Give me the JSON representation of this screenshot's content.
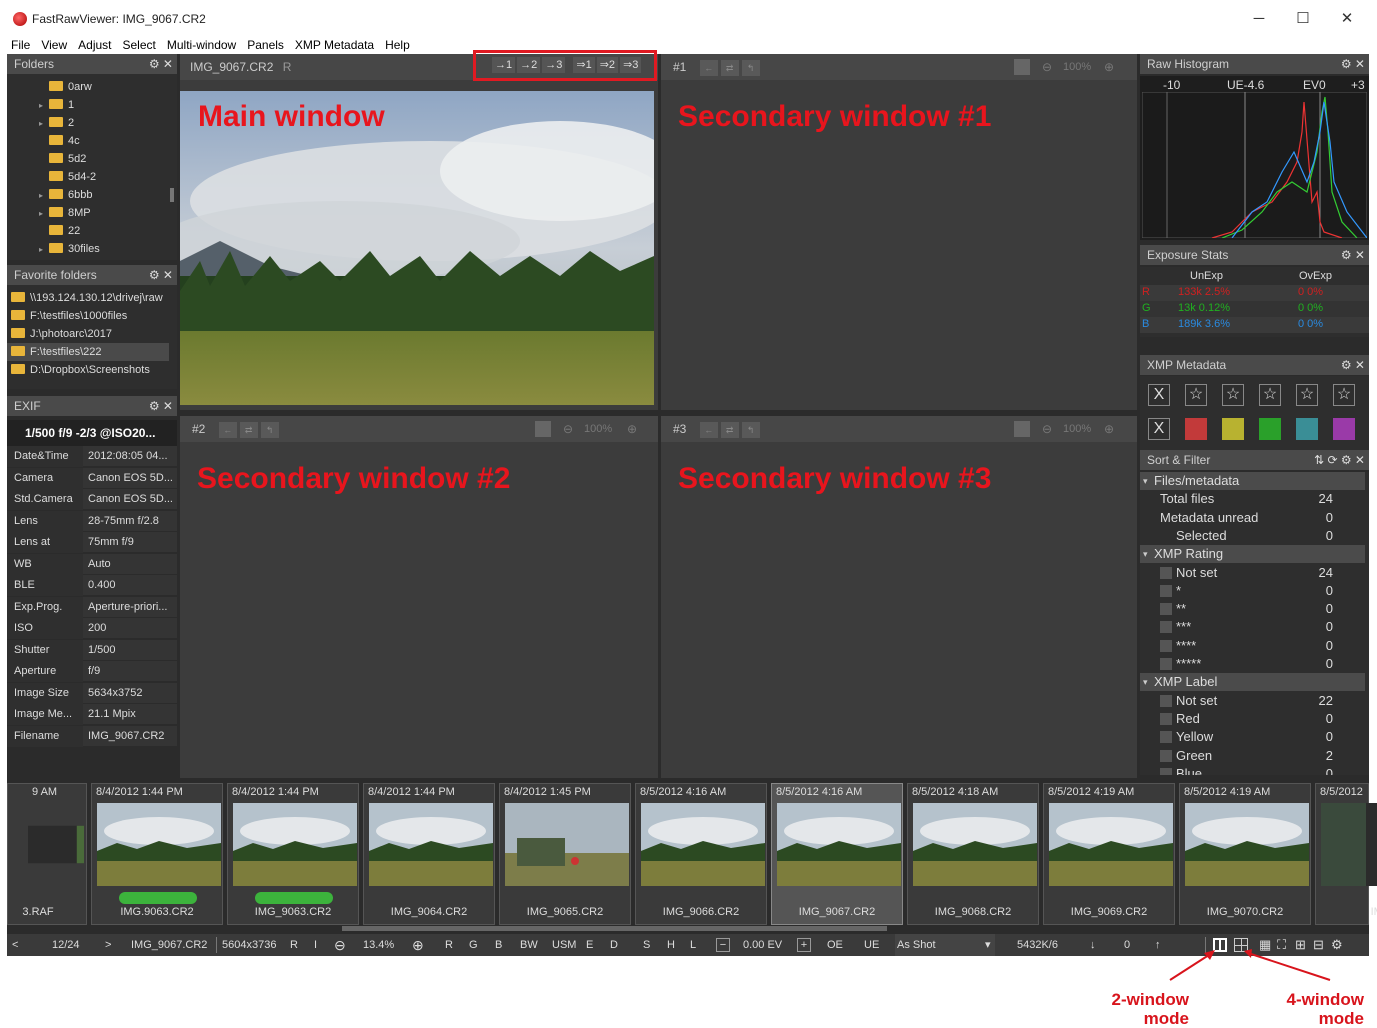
{
  "window": {
    "title": "FastRawViewer: IMG_9067.CR2",
    "min": "─",
    "max": "☐",
    "close": "✕"
  },
  "menu": [
    "File",
    "View",
    "Adjust",
    "Select",
    "Multi-window",
    "Panels",
    "XMP Metadata",
    "Help"
  ],
  "folders": {
    "title": "Folders",
    "items": [
      {
        "label": "0arw",
        "exp": ""
      },
      {
        "label": "1",
        "exp": "▸"
      },
      {
        "label": "2",
        "exp": "▸"
      },
      {
        "label": "4c",
        "exp": ""
      },
      {
        "label": "5d2",
        "exp": ""
      },
      {
        "label": "5d4-2",
        "exp": ""
      },
      {
        "label": "6bbb",
        "exp": "▸"
      },
      {
        "label": "8MP",
        "exp": "▸"
      },
      {
        "label": "22",
        "exp": ""
      },
      {
        "label": "30files",
        "exp": "▸"
      }
    ]
  },
  "favorites": {
    "title": "Favorite folders",
    "items": [
      "\\\\193.124.130.12\\drivej\\raw",
      "F:\\testfiles\\1000files",
      "J:\\photoarc\\2017",
      "F:\\testfiles\\222",
      "D:\\Dropbox\\Screenshots"
    ]
  },
  "exif": {
    "title": "EXIF",
    "summary": "1/500 f/9 -2/3 @ISO20...",
    "rows": [
      {
        "k": "Date&Time",
        "v": "2012:08:05 04..."
      },
      {
        "k": "Camera",
        "v": "Canon EOS 5D..."
      },
      {
        "k": "Std.Camera",
        "v": "Canon EOS 5D..."
      },
      {
        "k": "Lens",
        "v": "28-75mm f/2.8"
      },
      {
        "k": "Lens at",
        "v": "75mm f/9"
      },
      {
        "k": "WB",
        "v": "Auto"
      },
      {
        "k": "BLE",
        "v": "0.400"
      },
      {
        "k": "Exp.Prog.",
        "v": "Aperture-priori..."
      },
      {
        "k": "ISO",
        "v": "200"
      },
      {
        "k": "Shutter",
        "v": "1/500"
      },
      {
        "k": "Aperture",
        "v": "f/9"
      },
      {
        "k": "Image Size",
        "v": "5634x3752"
      },
      {
        "k": "Image Me...",
        "v": "21.1 Mpix"
      },
      {
        "k": "Filename",
        "v": "IMG_9067.CR2"
      }
    ]
  },
  "main": {
    "filename": "IMG_9067.CR2",
    "flag": "R",
    "label": "Main window",
    "push": [
      "→1",
      "→2",
      "→3",
      "⇒1",
      "⇒2",
      "⇒3"
    ]
  },
  "sec1": {
    "id": "#1",
    "zoom": "100%",
    "label": "Secondary window #1"
  },
  "sec2": {
    "id": "#2",
    "zoom": "100%",
    "label": "Secondary window #2"
  },
  "sec3": {
    "id": "#3",
    "zoom": "100%",
    "label": "Secondary window #3"
  },
  "histogram": {
    "title": "Raw Histogram",
    "labels": [
      "-10",
      "UE-4.6",
      "EV0",
      "+3"
    ]
  },
  "exposure": {
    "title": "Exposure Stats",
    "cols": [
      "UnExp",
      "OvExp"
    ],
    "rows": [
      {
        "ch": "R",
        "un": "133k 2.5%",
        "ov": "0 0%",
        "color": "#d02020"
      },
      {
        "ch": "G",
        "un": "13k 0.12%",
        "ov": "0 0%",
        "color": "#20b020"
      },
      {
        "ch": "B",
        "un": "189k 3.6%",
        "ov": "0 0%",
        "color": "#2a8adf"
      }
    ]
  },
  "xmp": {
    "title": "XMP Metadata",
    "reject": "X",
    "star": "☆",
    "colors": [
      "#c23a3a",
      "#b8b230",
      "#2aa02a",
      "#3a8e96",
      "#9a3aa8"
    ]
  },
  "sortfilter": {
    "title": "Sort & Filter",
    "rows": [
      {
        "t": "Files/metadata",
        "n": "",
        "g": true
      },
      {
        "t": "Total files",
        "n": "24",
        "i": 1
      },
      {
        "t": "Metadata unread",
        "n": "0",
        "i": 1
      },
      {
        "t": "Selected",
        "n": "0",
        "i": 2
      },
      {
        "t": "XMP Rating",
        "n": "",
        "g": true
      },
      {
        "t": "Not set",
        "n": "24",
        "cb": true
      },
      {
        "t": "*",
        "n": "0",
        "cb": true
      },
      {
        "t": "**",
        "n": "0",
        "cb": true
      },
      {
        "t": "***",
        "n": "0",
        "cb": true
      },
      {
        "t": "****",
        "n": "0",
        "cb": true
      },
      {
        "t": "*****",
        "n": "0",
        "cb": true
      },
      {
        "t": "XMP Label",
        "n": "",
        "g": true
      },
      {
        "t": "Not set",
        "n": "22",
        "cb": true
      },
      {
        "t": "Red",
        "n": "0",
        "cb": true
      },
      {
        "t": "Yellow",
        "n": "0",
        "cb": true
      },
      {
        "t": "Green",
        "n": "2",
        "cb": true
      },
      {
        "t": "Blue",
        "n": "0",
        "cb": true
      }
    ]
  },
  "filmstrip": [
    {
      "date": "9 AM",
      "file": "3.RAF",
      "label": false
    },
    {
      "date": "8/4/2012 1:44 PM",
      "file": "IMG.9063.CR2",
      "label": true
    },
    {
      "date": "8/4/2012 1:44 PM",
      "file": "IMG_9063.CR2",
      "label": true
    },
    {
      "date": "8/4/2012 1:44 PM",
      "file": "IMG_9064.CR2",
      "label": false
    },
    {
      "date": "8/4/2012 1:45 PM",
      "file": "IMG_9065.CR2",
      "label": false
    },
    {
      "date": "8/5/2012 4:16 AM",
      "file": "IMG_9066.CR2",
      "label": false
    },
    {
      "date": "8/5/2012 4:16 AM",
      "file": "IMG_9067.CR2",
      "label": false
    },
    {
      "date": "8/5/2012 4:18 AM",
      "file": "IMG_9068.CR2",
      "label": false
    },
    {
      "date": "8/5/2012 4:19 AM",
      "file": "IMG_9069.CR2",
      "label": false
    },
    {
      "date": "8/5/2012 4:19 AM",
      "file": "IMG_9070.CR2",
      "label": false
    },
    {
      "date": "8/5/2012",
      "file": "IMG",
      "label": false
    }
  ],
  "status": {
    "prev": "<",
    "pos": "12/24",
    "next": ">",
    "file": "IMG_9067.CR2",
    "dims": "5604x3736",
    "r": "R",
    "i": "I",
    "zoom": "13.4%",
    "ch": [
      "R",
      "G",
      "B",
      "BW",
      "USM",
      "E",
      "D",
      "S",
      "H",
      "L"
    ],
    "ev": "0.00 EV",
    "oe": "OE",
    "ue": "UE",
    "wb": "As Shot",
    "cache": "5432K/6",
    "num": "0"
  },
  "annotations": {
    "two": "2-window\nmode",
    "four": "4-window\nmode"
  }
}
